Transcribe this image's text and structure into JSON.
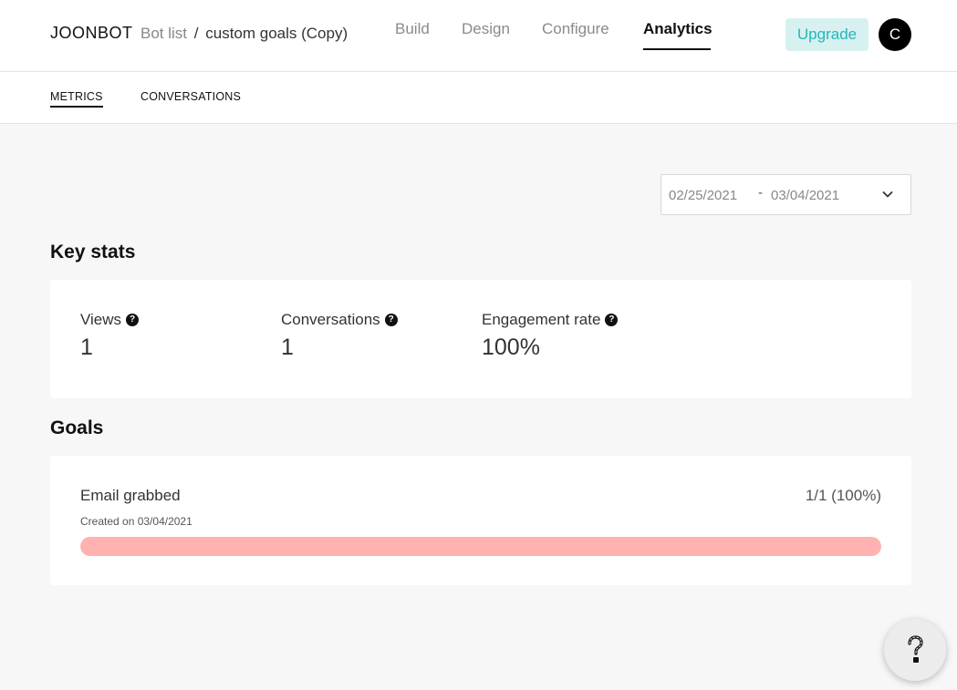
{
  "header": {
    "brand": "JOONBOT",
    "breadcrumb": {
      "bot_list": "Bot list",
      "separator": "/",
      "current": "custom goals (Copy)"
    },
    "nav": [
      {
        "label": "Build",
        "active": false
      },
      {
        "label": "Design",
        "active": false
      },
      {
        "label": "Configure",
        "active": false
      },
      {
        "label": "Analytics",
        "active": true
      }
    ],
    "upgrade_label": "Upgrade",
    "avatar_initial": "C"
  },
  "subtabs": [
    {
      "label": "METRICS",
      "active": true
    },
    {
      "label": "CONVERSATIONS",
      "active": false
    }
  ],
  "date_range": {
    "start": "02/25/2021",
    "separator": "-",
    "end": "03/04/2021",
    "icon": "chevron-down-icon"
  },
  "key_stats": {
    "title": "Key stats",
    "items": [
      {
        "label": "Views",
        "value": "1",
        "icon": "help-icon"
      },
      {
        "label": "Conversations",
        "value": "1",
        "icon": "help-icon"
      },
      {
        "label": "Engagement rate",
        "value": "100%",
        "icon": "help-icon"
      }
    ]
  },
  "goals": {
    "title": "Goals",
    "items": [
      {
        "name": "Email grabbed",
        "count": "1/1 (100%)",
        "created": "Created on 03/04/2021",
        "progress": 1.0
      }
    ]
  },
  "colors": {
    "accent": "#27b5b8",
    "progress": "#ffb2b0",
    "upgrade_bg": "#d7f1f1"
  }
}
